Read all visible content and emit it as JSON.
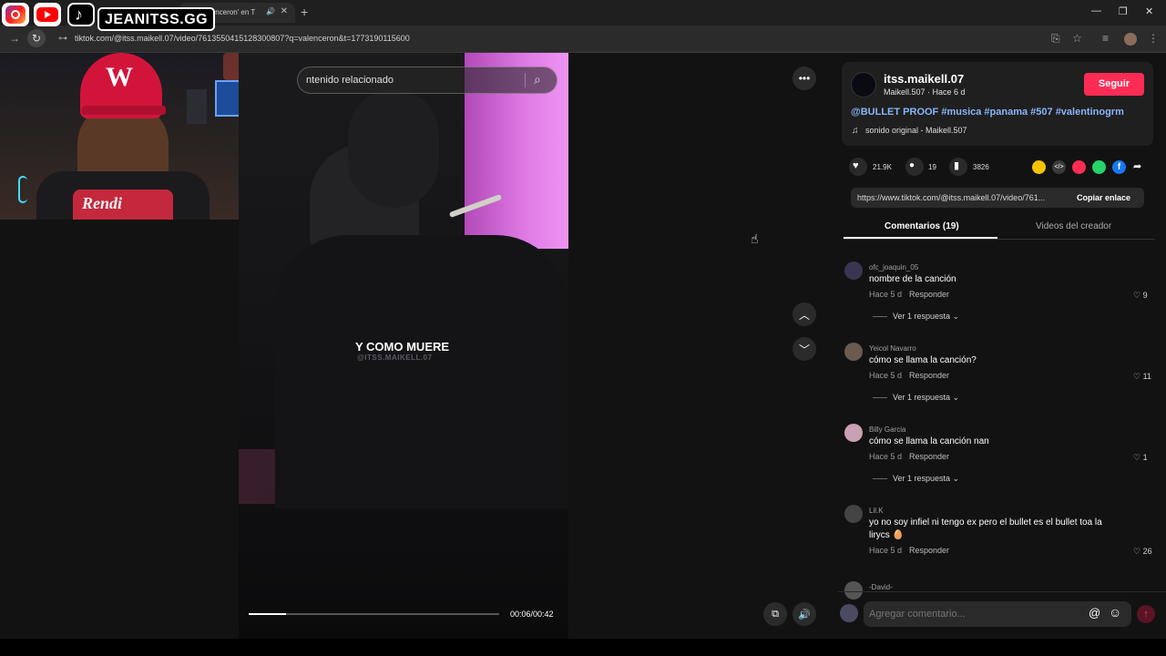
{
  "browser": {
    "tab_title": "ntra 'valenceron' en T",
    "new_tab_symbol": "+",
    "url": "tiktok.com/@itss.maikell.07/video/7613550415128300807?q=valenceron&t=1773190115600"
  },
  "overlay": {
    "brand": "JEANITSS.GG"
  },
  "video": {
    "search_text": "ntenido relacionado",
    "caption": "Y COMO MUERE",
    "watermark": "@ITSS.MAIKELL.07",
    "time": "00:06/00:42",
    "progress": 0.15
  },
  "author": {
    "username": "itss.maikell.07",
    "subtitle": "Maikell.507 · Hace 6 d",
    "follow_label": "Seguir",
    "description": "@BULLET PROOF #musica #panama #507 #valentinogrm",
    "sound": "sonido original - Maikell.507"
  },
  "stats": {
    "likes": "21.9K",
    "comments": "19",
    "saves": "3826"
  },
  "share": {
    "link": "https://www.tiktok.com/@itss.maikell.07/video/761...",
    "copy_label": "Copiar enlace"
  },
  "tabs": {
    "comments": "Comentarios (19)",
    "creator_videos": "Videos del creador"
  },
  "comments": [
    {
      "name": "ofc_joaquin_05",
      "text": "nombre de la canción",
      "time": "Hace 5 d",
      "reply": "Responder",
      "likes": "9",
      "more": "Ver 1 respuesta",
      "avatar_color": "#3a3550"
    },
    {
      "name": "Yeicol Navarro",
      "text": "cómo se llama la canción?",
      "time": "Hace 5 d",
      "reply": "Responder",
      "likes": "11",
      "more": "Ver 1 respuesta",
      "avatar_color": "#6b5a50"
    },
    {
      "name": "Billy Garcia",
      "text": "cómo se llama la canción nan",
      "time": "Hace 5 d",
      "reply": "Responder",
      "likes": "1",
      "more": "Ver 1 respuesta",
      "avatar_color": "#c9a0b4"
    },
    {
      "name": "Lil.K",
      "text": "yo no soy infiel ni tengo ex pero el bullet es el bullet toa la lirycs 🥚",
      "time": "Hace 5 d",
      "reply": "Responder",
      "likes": "26",
      "more": "",
      "avatar_color": "#444"
    },
    {
      "name": "-David-",
      "text": "",
      "time": "",
      "reply": "",
      "likes": "",
      "more": "",
      "avatar_color": "#555"
    }
  ],
  "comment_input": {
    "placeholder": "Agregar comentario..."
  },
  "colors": {
    "accent": "#fe2c55",
    "hashtag": "#8ab4f8"
  }
}
